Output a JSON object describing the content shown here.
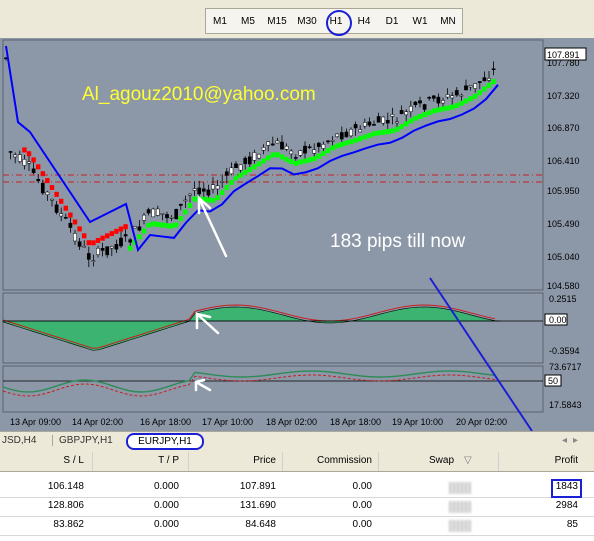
{
  "timeframes": [
    "M1",
    "M5",
    "M15",
    "M30",
    "H1",
    "H4",
    "D1",
    "W1",
    "MN"
  ],
  "selected_timeframe": "H1",
  "chart": {
    "annotation_email": "Al_agouz2010@yahoo.com",
    "annotation_pips": "183 pips till now",
    "price_labels": [
      "107.891",
      "107.780",
      "107.320",
      "106.870",
      "106.410",
      "105.950",
      "105.490",
      "105.040",
      "104.580"
    ],
    "current_price": "107.891",
    "ind1_labels": [
      "0.2515",
      "0.00",
      "-0.3594"
    ],
    "ind2_labels": [
      "73.6717",
      "50",
      "17.5843"
    ],
    "time_labels": [
      "13 Apr 09:00",
      "14 Apr 02:00",
      "16 Apr 18:00",
      "17 Apr 10:00",
      "18 Apr 02:00",
      "18 Apr 18:00",
      "19 Apr 10:00",
      "20 Apr 02:00"
    ],
    "colors": {
      "background": "#8c98a8",
      "bull": "#ffffff",
      "bear": "#000000",
      "ma_up": "#00ff00",
      "ma_down": "#ff0000",
      "line": "#0000ff",
      "annotation_yellow": "#ffff33",
      "annotation_blue": "#1b20d6"
    }
  },
  "tabs": [
    "JSD,H4",
    "GBPJPY,H1",
    "EURJPY,H1"
  ],
  "active_tab": "EURJPY,H1",
  "table": {
    "headers": [
      "S / L",
      "T / P",
      "Price",
      "Commission",
      "Swap",
      "Profit"
    ],
    "rows": [
      [
        "106.148",
        "0.000",
        "107.891",
        "0.00",
        "",
        "1843"
      ],
      [
        "128.806",
        "0.000",
        "131.690",
        "0.00",
        "",
        "2984"
      ],
      [
        "83.862",
        "0.000",
        "84.648",
        "0.00",
        "",
        "85"
      ]
    ]
  }
}
